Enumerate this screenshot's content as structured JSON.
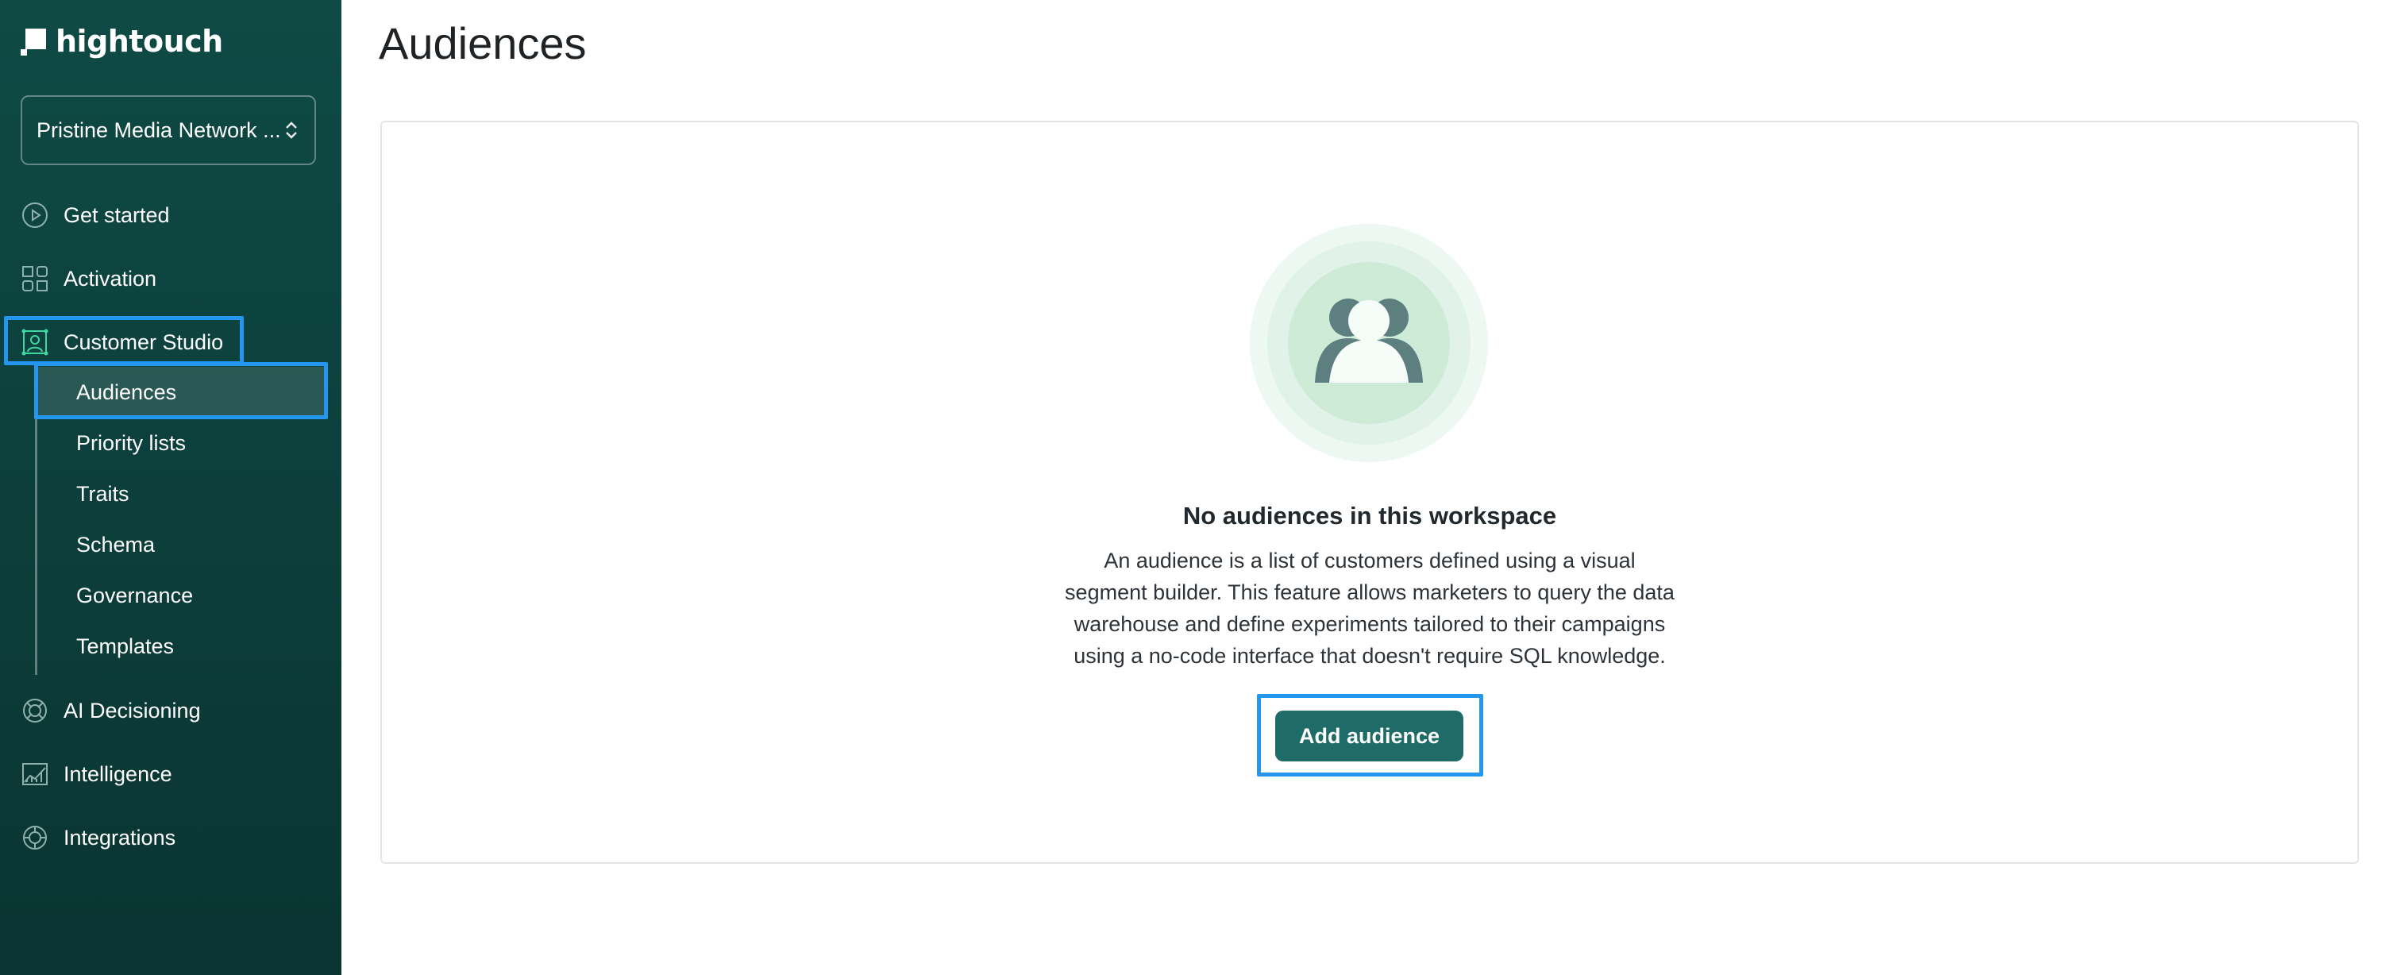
{
  "brand": {
    "name": "hightouch"
  },
  "workspace": {
    "label": "Pristine Media Network ..."
  },
  "nav": {
    "items": [
      {
        "label": "Get started",
        "icon": "play-circle-icon"
      },
      {
        "label": "Activation",
        "icon": "grid-icon"
      },
      {
        "label": "Customer Studio",
        "icon": "user-frame-icon"
      },
      {
        "label": "AI Decisioning",
        "icon": "ai-icon"
      },
      {
        "label": "Intelligence",
        "icon": "chart-icon"
      },
      {
        "label": "Integrations",
        "icon": "integrations-icon"
      }
    ],
    "sub_items": [
      {
        "label": "Audiences"
      },
      {
        "label": "Priority lists"
      },
      {
        "label": "Traits"
      },
      {
        "label": "Schema"
      },
      {
        "label": "Governance"
      },
      {
        "label": "Templates"
      }
    ]
  },
  "main": {
    "title": "Audiences",
    "empty_state": {
      "title": "No audiences in this workspace",
      "desc_lines": [
        "An audience is a list of customers defined using a visual",
        "segment builder. This feature allows marketers to query the data",
        "warehouse and define experiments tailored to their campaigns",
        "using a no-code interface that doesn't require SQL knowledge."
      ],
      "button": "Add audience"
    }
  },
  "colors": {
    "sidebar": "#0f4a45",
    "accent": "#1e6b68",
    "highlight": "#2596ee",
    "active_icon": "#3fd6a0"
  }
}
